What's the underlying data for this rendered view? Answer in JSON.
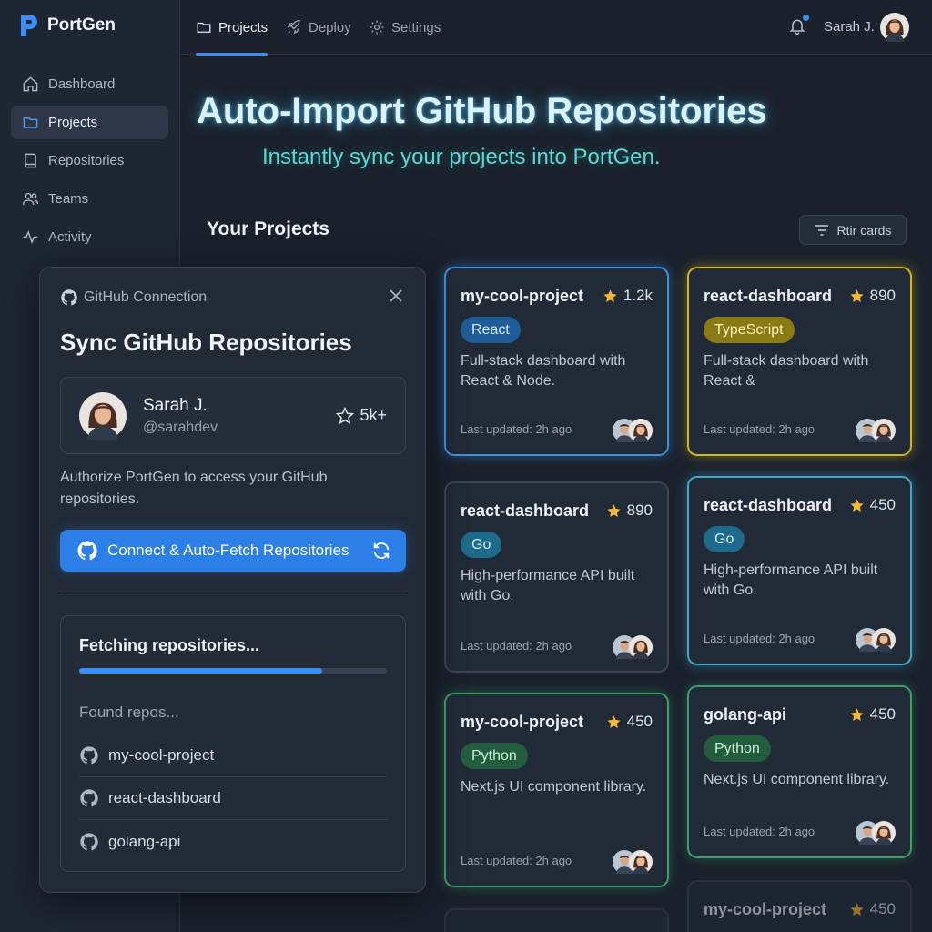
{
  "app": {
    "name": "PortGen"
  },
  "sidebar": {
    "items": [
      {
        "label": "Dashboard",
        "icon": "home-icon"
      },
      {
        "label": "Projects",
        "icon": "folder-icon",
        "active": true
      },
      {
        "label": "Repositories",
        "icon": "book-icon"
      },
      {
        "label": "Teams",
        "icon": "users-icon"
      },
      {
        "label": "Activity",
        "icon": "activity-icon"
      }
    ]
  },
  "topbar": {
    "tabs": [
      {
        "label": "Projects",
        "icon": "folder-icon",
        "active": true
      },
      {
        "label": "Deploy",
        "icon": "rocket-icon"
      },
      {
        "label": "Settings",
        "icon": "gear-icon"
      }
    ],
    "user_name": "Sarah J."
  },
  "hero": {
    "title": "Auto-Import GitHub Repositories",
    "subtitle": "Instantly sync your projects into PortGen."
  },
  "projects": {
    "section_title": "Your Projects",
    "filter_label": "Rtir cards",
    "cards": [
      {
        "name": "my-cool-project",
        "stars": "1.2k",
        "lang": "React",
        "desc": "Full-stack dashboard with React & Node.",
        "updated": "Last updated: 2h ago"
      },
      {
        "name": "react-dashboard",
        "stars": "890",
        "lang": "TypeScript",
        "desc": "Full-stack dashboard with React &",
        "updated": "Last updated: 2h ago"
      },
      {
        "name": "react-dashboard",
        "stars": "890",
        "lang": "Go",
        "desc": "High-performance API built with Go.",
        "updated": "Last updated: 2h ago"
      },
      {
        "name": "react-dashboard",
        "stars": "450",
        "lang": "Go",
        "desc": "High-performance API built with Go.",
        "updated": "Last updated: 2h ago"
      },
      {
        "name": "my-cool-project",
        "stars": "450",
        "lang": "Python",
        "desc": "Next.js UI component library.",
        "updated": "Last updated: 2h ago"
      },
      {
        "name": "golang-api",
        "stars": "450",
        "lang": "Python",
        "desc": "Next.js UI component library.",
        "updated": "Last updated: 2h ago"
      },
      {
        "name": "my-cool-project",
        "stars": "450"
      }
    ]
  },
  "modal": {
    "header": "GitHub Connection",
    "title": "Sync GitHub Repositories",
    "user": {
      "name": "Sarah J.",
      "handle": "@sarahdev",
      "stars": "5k+"
    },
    "auth_text": "Authorize PortGen to access your GitHub repositories.",
    "connect_label": "Connect & Auto-Fetch Repositories",
    "fetch": {
      "title": "Fetching repositories...",
      "progress": 0.79,
      "found_label": "Found repos...",
      "repos": [
        "my-cool-project",
        "react-dashboard",
        "golang-api"
      ]
    }
  },
  "colors": {
    "accent": "#3b8ef5",
    "react": "#1f5d99",
    "typescript": "#8a7a14",
    "go": "#1e6a8a",
    "python": "#245c3e",
    "star": "#f5b82e"
  }
}
